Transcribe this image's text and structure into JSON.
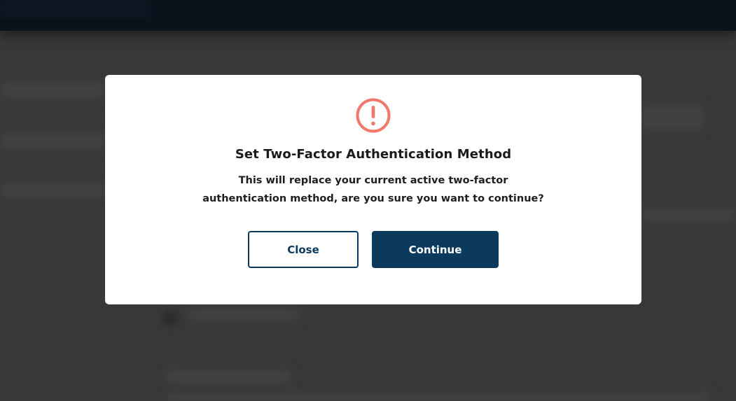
{
  "dialog": {
    "title": "Set Two-Factor Authentication Method",
    "message": "This will replace your current active two-factor authentication method, are you sure you want to continue?",
    "icon": "warning-circle-icon",
    "accent_color": "#f2786a",
    "close_label": "Close",
    "continue_label": "Continue",
    "primary_color": "#0b3a5d"
  }
}
